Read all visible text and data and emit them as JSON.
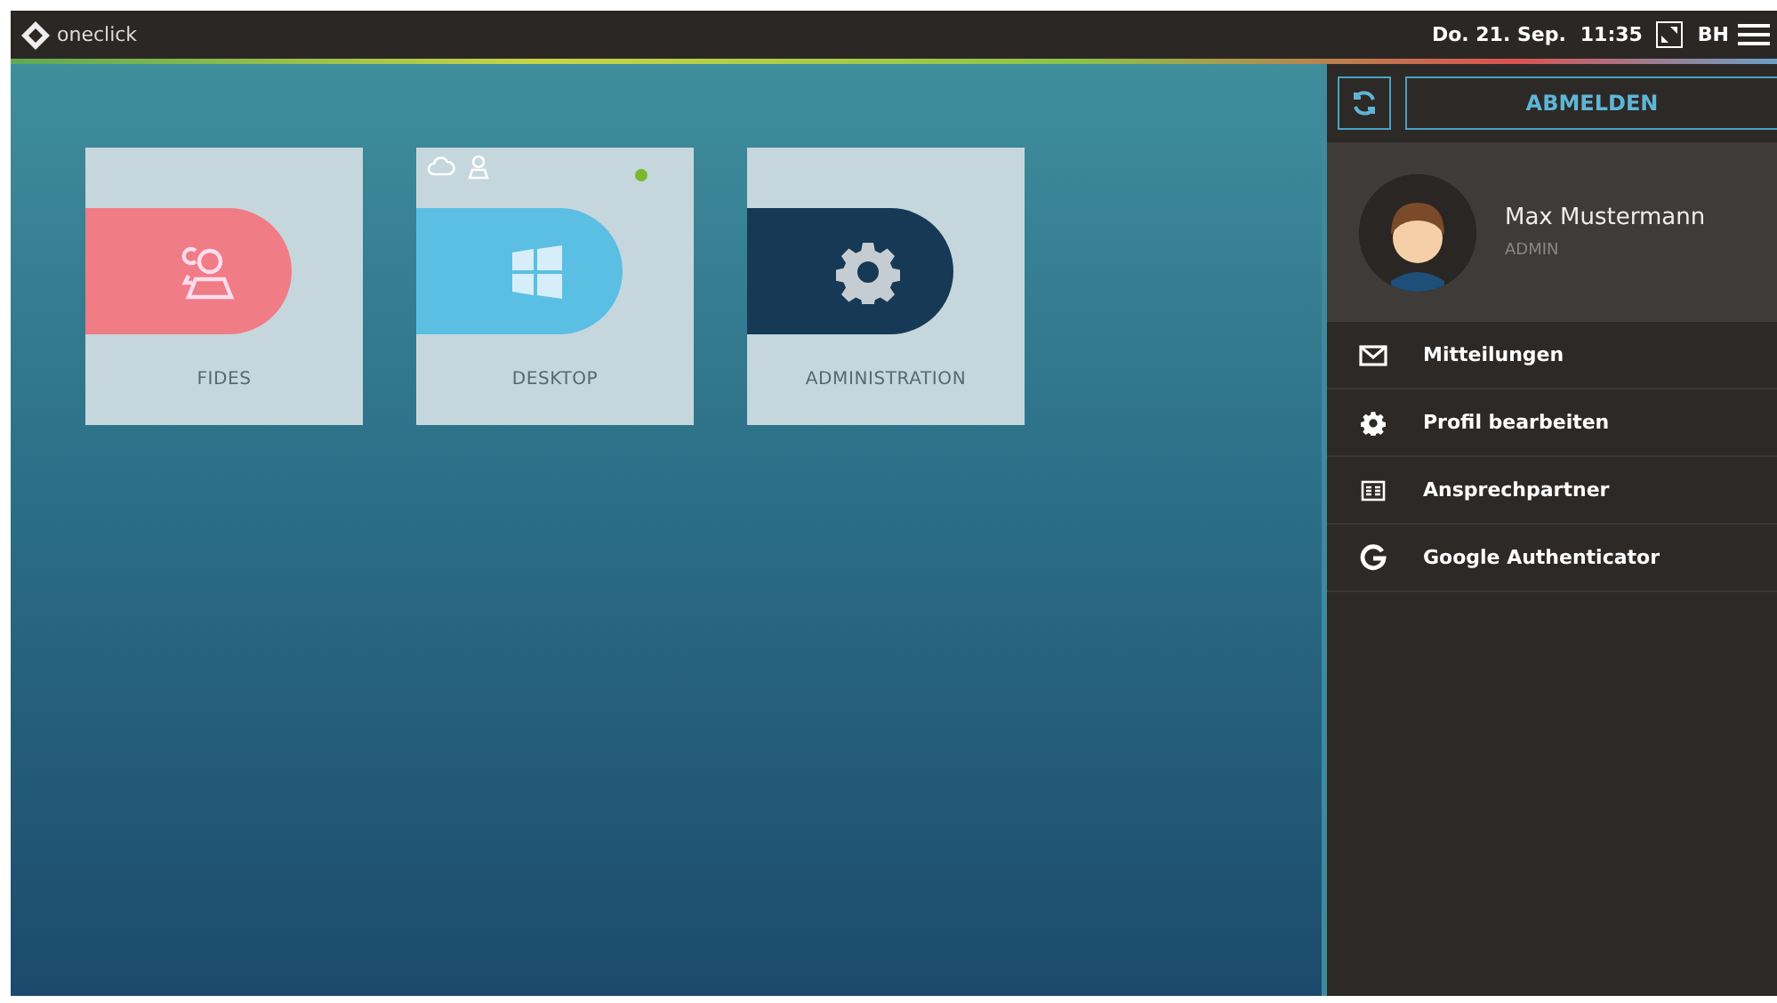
{
  "topbar": {
    "logo": "oneclick",
    "date": "Do. 21. Sep.",
    "time": "11:35",
    "initials": "BH"
  },
  "tiles": [
    {
      "label": "FIDES",
      "kind": "people",
      "color": "#f07c86",
      "online": false
    },
    {
      "label": "DESKTOP",
      "kind": "windows",
      "color": "#5bbfe3",
      "online": true
    },
    {
      "label": "ADMINISTRATION",
      "kind": "gear",
      "color": "#163a56",
      "online": false
    }
  ],
  "panel": {
    "logout": "ABMELDEN",
    "user": {
      "name": "Max Mustermann",
      "role": "ADMIN"
    },
    "menu": [
      {
        "label": "Mitteilungen",
        "kind": "mail"
      },
      {
        "label": "Profil bearbeiten",
        "kind": "gear"
      },
      {
        "label": "Ansprechpartner",
        "kind": "card"
      },
      {
        "label": "Google Authenticator",
        "kind": "google"
      }
    ]
  }
}
